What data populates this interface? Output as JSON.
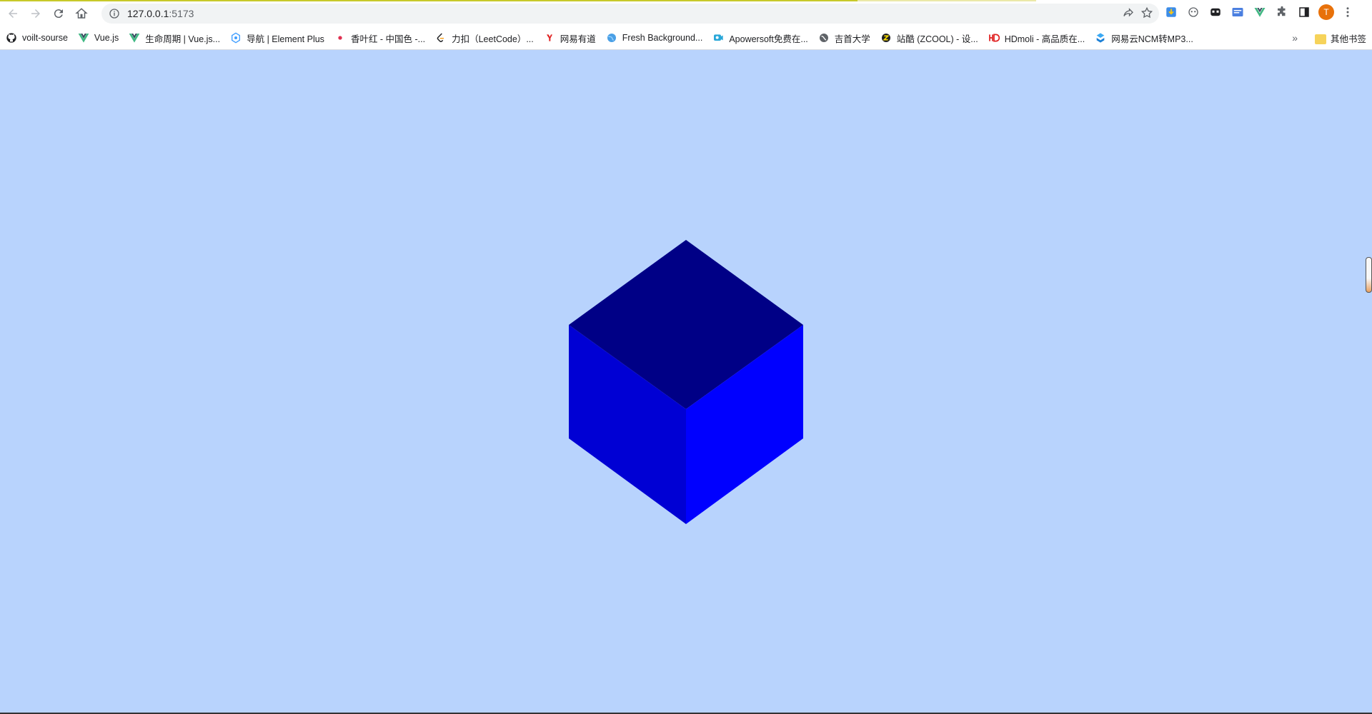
{
  "browser": {
    "url": "127.0.0.1",
    "port": ":5173",
    "avatar_letter": "T"
  },
  "bookmarks": [
    {
      "label": "voilt-sourse",
      "icon": "github-icon"
    },
    {
      "label": "Vue.js",
      "icon": "vue-icon"
    },
    {
      "label": "生命周期 | Vue.js...",
      "icon": "vue-icon"
    },
    {
      "label": "导航 | Element Plus",
      "icon": "element-plus-icon"
    },
    {
      "label": "香叶红 - 中国色 -...",
      "icon": "red-dot-icon"
    },
    {
      "label": "力扣（LeetCode）...",
      "icon": "leetcode-icon"
    },
    {
      "label": "网易有道",
      "icon": "youdao-icon"
    },
    {
      "label": "Fresh Background...",
      "icon": "globe-icon"
    },
    {
      "label": "Apowersoft免费在...",
      "icon": "apowersoft-icon"
    },
    {
      "label": "吉首大学",
      "icon": "globe-gray-icon"
    },
    {
      "label": "站酷 (ZCOOL) - 设...",
      "icon": "zcool-icon"
    },
    {
      "label": "HDmoli - 高品质在...",
      "icon": "hd-icon"
    },
    {
      "label": "网易云NCM转MP3...",
      "icon": "ncm-icon"
    }
  ],
  "other_bookmarks_label": "其他书签",
  "colors": {
    "page_background": "#b8d3fd",
    "cube_top": "#000086",
    "cube_left": "#0000d4",
    "cube_right": "#0000ff"
  }
}
